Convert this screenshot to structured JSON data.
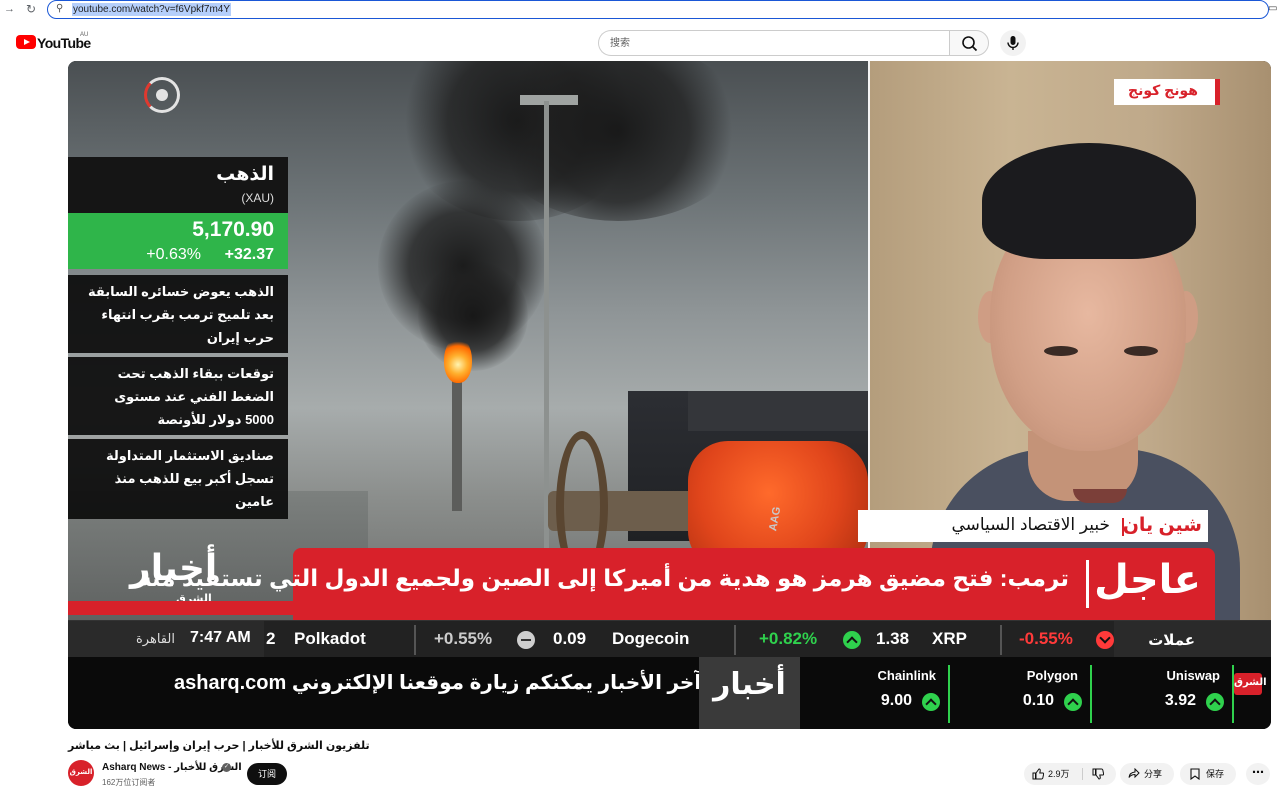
{
  "browser": {
    "url": "youtube.com/watch?v=f6Vpkf7m4Y"
  },
  "youtube": {
    "logo_text": "YouTube",
    "region": "AU",
    "search_placeholder": "搜索"
  },
  "video": {
    "gold": {
      "name": "الذهب",
      "symbol": "(XAU)",
      "price": "5,170.90",
      "change_abs": "+32.37",
      "change_pct": "+0.63%",
      "news": [
        "الذهب يعوض خسائره السابقة بعد تلميح ترمب بقرب انتهاء حرب إيران",
        "توقعات ببقاء الذهب تحت الضغط الفني عند مستوى 5000 دولار للأونصة",
        "صناديق الاستثمار المتداولة تسجل أكبر بيع للذهب منذ عامين"
      ]
    },
    "akhbar_logo": "أخبار",
    "akhbar_sub": "الشرق",
    "valve_text": "AAG",
    "location": "هونج كونج",
    "guest": {
      "name": "شين يان",
      "title": "خبير الاقتصاد السياسي"
    },
    "breaking": {
      "label": "عاجل",
      "headline": "ترمب: فتح مضيق هرمز هو هدية من أميركا إلى الصين ولجميع الدول التي تستفيد منه"
    },
    "ticker": {
      "time": "7:47 AM",
      "city": "القاهرة",
      "label": "عملات",
      "items": [
        {
          "lead": "2"
        },
        {
          "name": "Polkadot"
        },
        {
          "change": "+0.55%"
        },
        {
          "price": "0.09",
          "name": "Dogecoin"
        },
        {
          "change": "+0.82%"
        },
        {
          "price": "1.38",
          "name": "XRP"
        },
        {
          "change": "-0.55%"
        }
      ]
    },
    "bottom": {
      "promo": "لمتابعة آخر الأخبار يمكنكم زيارة موقعنا الإلكتروني asharq.com",
      "akhbar": "أخبار",
      "coins": [
        {
          "name": "Chainlink",
          "price": "9.00"
        },
        {
          "name": "Polygon",
          "price": "0.10"
        },
        {
          "name": "Uniswap",
          "price": "3.92"
        }
      ],
      "brand": "الشرق"
    }
  },
  "below": {
    "title": "تلفزيون الشرق للأخبار | حرب إيران وإسرائيل | بث مباشر",
    "channel_name": "Asharq News - الشرق للأخبار",
    "avatar_text": "الشرق",
    "subscribers": "162万位订阅者",
    "subscribe": "订阅",
    "likes": "2.9万",
    "share": "分享",
    "save": "保存"
  },
  "colors": {
    "accent_red": "#d8212a",
    "gain_green": "#2fd14d",
    "loss_red": "#ff3a3a",
    "yt_red": "#ff0000"
  }
}
